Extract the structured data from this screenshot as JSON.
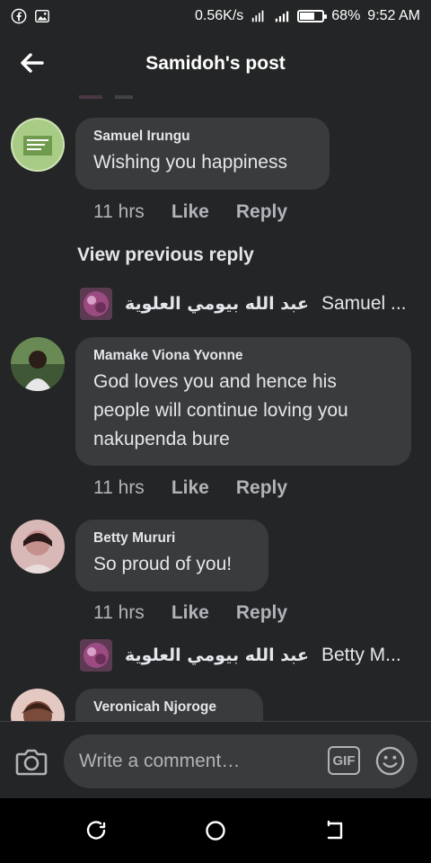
{
  "status_bar": {
    "net_speed": "0.56K/s",
    "battery_percent": "68%",
    "battery_level": 0.68,
    "time": "9:52 AM",
    "icons": [
      "facebook-icon",
      "gallery-icon",
      "hotspot-icon",
      "signal-icon",
      "battery-icon"
    ]
  },
  "header": {
    "title": "Samidoh's post",
    "back_icon": "arrow-left-icon"
  },
  "comments": [
    {
      "name": "Samuel Irungu",
      "text": "Wishing you happiness",
      "time": "11 hrs",
      "like": "Like",
      "reply": "Reply"
    },
    {
      "name": "Mamake Viona Yvonne",
      "text": "God loves you and hence his people will continue loving you nakupenda bure",
      "time": "11 hrs",
      "like": "Like",
      "reply": "Reply"
    },
    {
      "name": "Betty Mururi",
      "text": "So proud of you!",
      "time": "11 hrs",
      "like": "Like",
      "reply": "Reply"
    },
    {
      "name": "Veronicah Njoroge"
    }
  ],
  "view_previous": "View previous reply",
  "reply_previews": [
    {
      "author": "عبد الله بيومي العلوية",
      "snippet": "Samuel ..."
    },
    {
      "author": "عبد الله بيومي العلوية",
      "snippet": "Betty M..."
    }
  ],
  "composer": {
    "placeholder": "Write a comment…",
    "gif_label": "GIF",
    "icons": [
      "camera-icon",
      "gif-icon",
      "emoji-icon"
    ]
  },
  "nav_bar": {
    "icons": [
      "recent-apps-icon",
      "home-icon",
      "back-icon"
    ]
  },
  "colors": {
    "background": "#242526",
    "bubble": "#3a3b3c",
    "text_primary": "#e4e6eb",
    "text_secondary": "#b0b3b8",
    "nav_background": "#000000"
  }
}
